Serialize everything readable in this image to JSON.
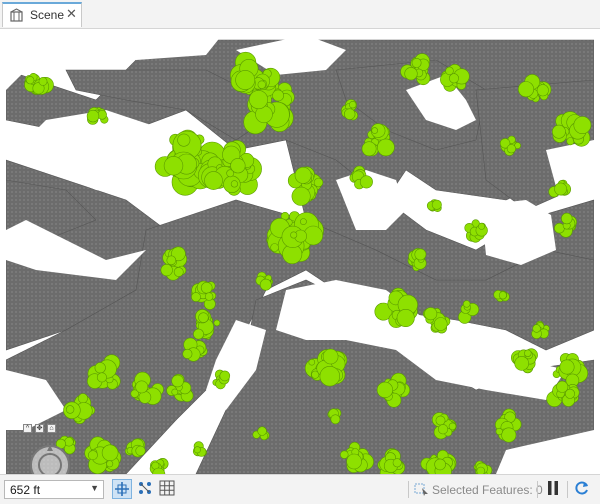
{
  "tab": {
    "label": "Scene",
    "close_glyph": "✕",
    "icon": "scene-globe-icon"
  },
  "statusbar": {
    "scale_value": "652 ft",
    "scale_dropdown_glyph": "▼",
    "selected_features": "Selected Features: 0",
    "pause_icon": "pause-icon",
    "refresh_icon": "refresh-icon"
  },
  "navigator": {
    "mini_buttons": [
      "^",
      "✥",
      "⌂"
    ]
  },
  "colors": {
    "ground": "#6f6f6f",
    "trees": "#8ee000",
    "tree_edge": "#5a9a00",
    "accent": "#2a7fd4"
  }
}
